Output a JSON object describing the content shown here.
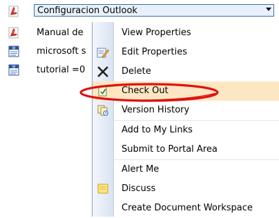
{
  "documents": [
    {
      "name": "Configuracion Outlook",
      "icon": "pdf-icon",
      "selected": true
    },
    {
      "name": "Manual de",
      "icon": "pdf-icon"
    },
    {
      "name": "microsoft s",
      "icon": "word-doc-icon"
    },
    {
      "name": "tutorial =0",
      "icon": "word-doc-icon"
    }
  ],
  "menu": {
    "items": [
      {
        "label": "View Properties",
        "icon": ""
      },
      {
        "label": "Edit Properties",
        "icon": "edit-properties-icon"
      },
      {
        "label": "Delete",
        "icon": "delete-x-icon"
      },
      {
        "label": "Check Out",
        "icon": "check-out-icon",
        "annotated": true
      },
      {
        "label": "Version History",
        "icon": "version-history-icon"
      },
      {
        "label": "Add to My Links",
        "icon": ""
      },
      {
        "label": "Submit to Portal Area",
        "icon": ""
      },
      {
        "label": "Alert Me",
        "icon": ""
      },
      {
        "label": "Discuss",
        "icon": "discuss-note-icon"
      },
      {
        "label": "Create Document Workspace",
        "icon": ""
      }
    ]
  },
  "colors": {
    "annotation": "#e01010",
    "menu_border": "#8a9fc2",
    "selection_border": "#3a6ea5"
  }
}
